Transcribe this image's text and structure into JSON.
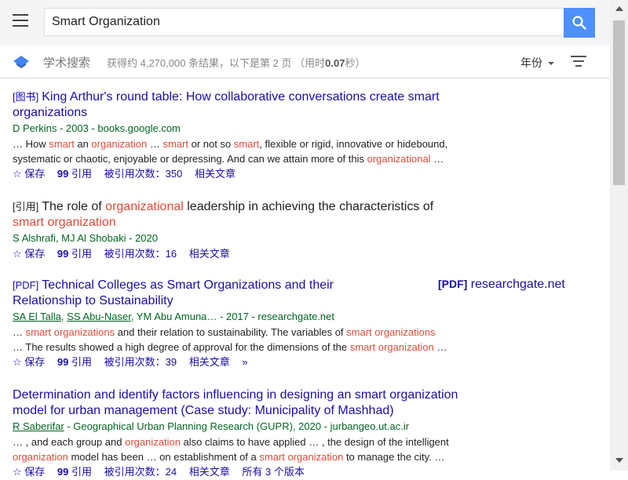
{
  "search": {
    "query": "Smart Organization"
  },
  "subbar": {
    "scholar_label": "学术搜索",
    "stats_prefix": "获得约 4,270,000 条结果，以下是第 2 页 （用时",
    "stats_time": "0.07",
    "stats_suffix": "秒）",
    "year_label": "年份"
  },
  "actions": {
    "save": "保存",
    "cite": "引用",
    "related": "相关文章"
  },
  "results": [
    {
      "tag": "[图书]",
      "title_parts": [
        "King Arthur's round table: How collaborative conversations create ",
        "smart",
        " ",
        "organizations"
      ],
      "meta": "D Perkins - 2003 - books.google.com",
      "snippet_1": [
        "… How ",
        "smart",
        " an ",
        "organization",
        " … ",
        "smart",
        " or not so ",
        "smart",
        ", flexible or rigid, innovative or hidebound,"
      ],
      "snippet_2": [
        "systematic or chaotic, enjoyable or depressing. And can we attain more of this ",
        "organizational",
        " …"
      ],
      "cited_by": "被引用次数：350"
    },
    {
      "tag": "[引用]",
      "title_parts": [
        "The role of ",
        "organizational",
        " leadership in achieving the characteristics of ",
        "smart organization"
      ],
      "meta": "S Alshrafi, MJ Al Shobaki - 2020",
      "cited_by": "被引用次数：16"
    },
    {
      "tag": "[PDF]",
      "title_parts": [
        "Technical Colleges as ",
        "Smart Organizations",
        " and their ",
        "Relationship to Sustainability"
      ],
      "meta_authors": [
        "SA El Talla",
        "SS Abu-Naser"
      ],
      "meta_rest": ", YM Abu Amuna… - 2017 - researchgate.net",
      "snippet_1": [
        "… ",
        "smart organizations",
        " and their relation to sustainability. The variables of ",
        "smart organizations"
      ],
      "snippet_2": [
        "… The results showed a high degree of approval for the dimensions of the ",
        "smart organization",
        " …"
      ],
      "cited_by": "被引用次数：39",
      "side_tag": "[PDF]",
      "side_domain": "researchgate.net"
    },
    {
      "title_parts": [
        "Determination and identify factors influencing in designing an ",
        "smart organization",
        " model for urban management (Case study: Municipality of Mashhad)"
      ],
      "meta_author": "R Saberifar",
      "meta_rest": " - Geographical Urban Planning Research (GUPR), 2020 - jurbangeo.ut.ac.ir",
      "snippet_1": [
        "… , and each group and ",
        "organization",
        " also claims to have applied … , the design of the intelligent"
      ],
      "snippet_2": [
        "organization",
        " model has been … on establishment of a ",
        "smart organization",
        " to manage the city. …"
      ],
      "cited_by": "被引用次数：24",
      "versions": "所有 3 个版本"
    }
  ]
}
